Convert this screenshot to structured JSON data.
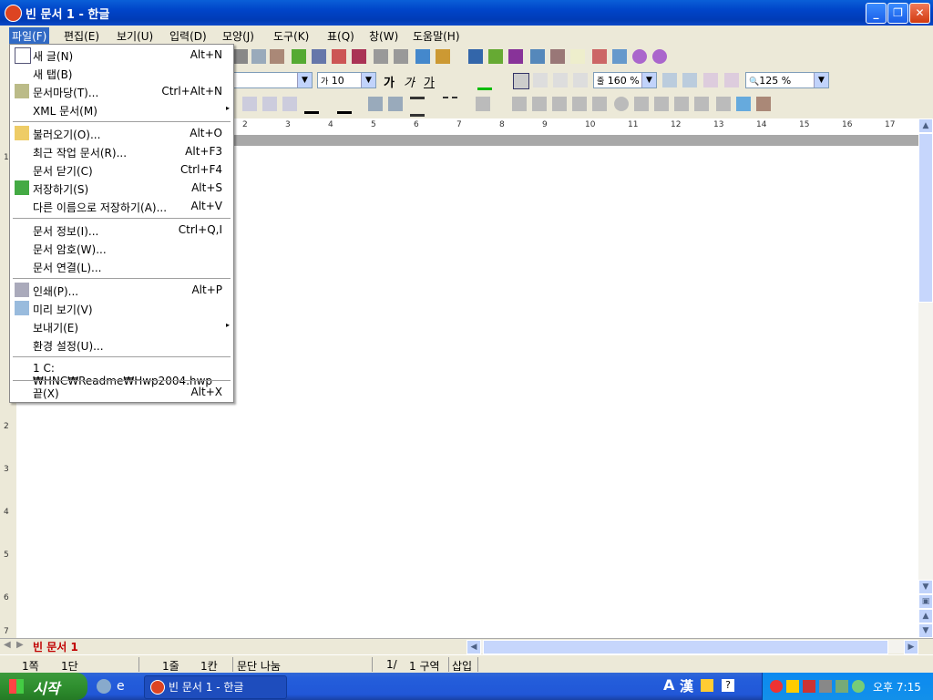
{
  "window": {
    "title": "빈 문서 1 - 한글",
    "minimize": "_",
    "maximize": "❐",
    "close": "✕"
  },
  "menubar": [
    "파일(F)",
    "편집(E)",
    "보기(U)",
    "입력(D)",
    "모양(J)",
    "도구(K)",
    "표(Q)",
    "창(W)",
    "도움말(H)"
  ],
  "file_menu": {
    "items": [
      {
        "label": "새 글(N)",
        "shortcut": "Alt+N",
        "icon": "new-doc-icon"
      },
      {
        "label": "새 탭(B)",
        "shortcut": ""
      },
      {
        "label": "문서마당(T)...",
        "shortcut": "Ctrl+Alt+N",
        "icon": "template-icon"
      },
      {
        "label": "XML 문서(M)",
        "shortcut": "",
        "submenu": true
      },
      {
        "label": "불러오기(O)...",
        "shortcut": "Alt+O",
        "icon": "open-folder-icon"
      },
      {
        "label": "최근 작업 문서(R)...",
        "shortcut": "Alt+F3"
      },
      {
        "label": "문서 닫기(C)",
        "shortcut": "Ctrl+F4"
      },
      {
        "label": "저장하기(S)",
        "shortcut": "Alt+S",
        "icon": "save-icon"
      },
      {
        "label": "다른 이름으로 저장하기(A)...",
        "shortcut": "Alt+V"
      },
      {
        "label": "문서 정보(I)...",
        "shortcut": "Ctrl+Q,I"
      },
      {
        "label": "문서 암호(W)...",
        "shortcut": ""
      },
      {
        "label": "문서 연결(L)...",
        "shortcut": ""
      },
      {
        "label": "인쇄(P)...",
        "shortcut": "Alt+P",
        "icon": "printer-icon"
      },
      {
        "label": "미리 보기(V)",
        "shortcut": "",
        "icon": "preview-icon"
      },
      {
        "label": "보내기(E)",
        "shortcut": "",
        "submenu": true
      },
      {
        "label": "환경 설정(U)...",
        "shortcut": ""
      },
      {
        "label": "1 C:₩HNC₩Readme₩Hwp2004.hwp",
        "shortcut": ""
      },
      {
        "label": "끝(X)",
        "shortcut": "Alt+X"
      }
    ]
  },
  "toolbar": {
    "font_size": "10",
    "line_spacing": "160 %",
    "zoom": "125 %",
    "bold": "가",
    "italic": "가",
    "underline": "가",
    "line_spacing_icon": "줄",
    "font_size_icon": "가",
    "zoom_icon": "🔍"
  },
  "ruler": [
    "2",
    "3",
    "4",
    "5",
    "6",
    "7",
    "8",
    "9",
    "10",
    "11",
    "12",
    "13",
    "14",
    "15",
    "16",
    "17"
  ],
  "vruler": [
    "1",
    "2",
    "3",
    "4",
    "5",
    "6",
    "7"
  ],
  "doc_tab": "빈 문서 1",
  "status": {
    "page": "1쪽",
    "section": "1단",
    "line": "1줄",
    "col": "1칸",
    "para_break": "문단 나눔",
    "page_of": "1/",
    "zone": "1 구역",
    "insert": "삽입"
  },
  "taskbar": {
    "start": "시작",
    "task": "빈 문서 1 - 한글",
    "clock": "오후 7:15",
    "ime_a": "A",
    "ime_han": "漢"
  }
}
